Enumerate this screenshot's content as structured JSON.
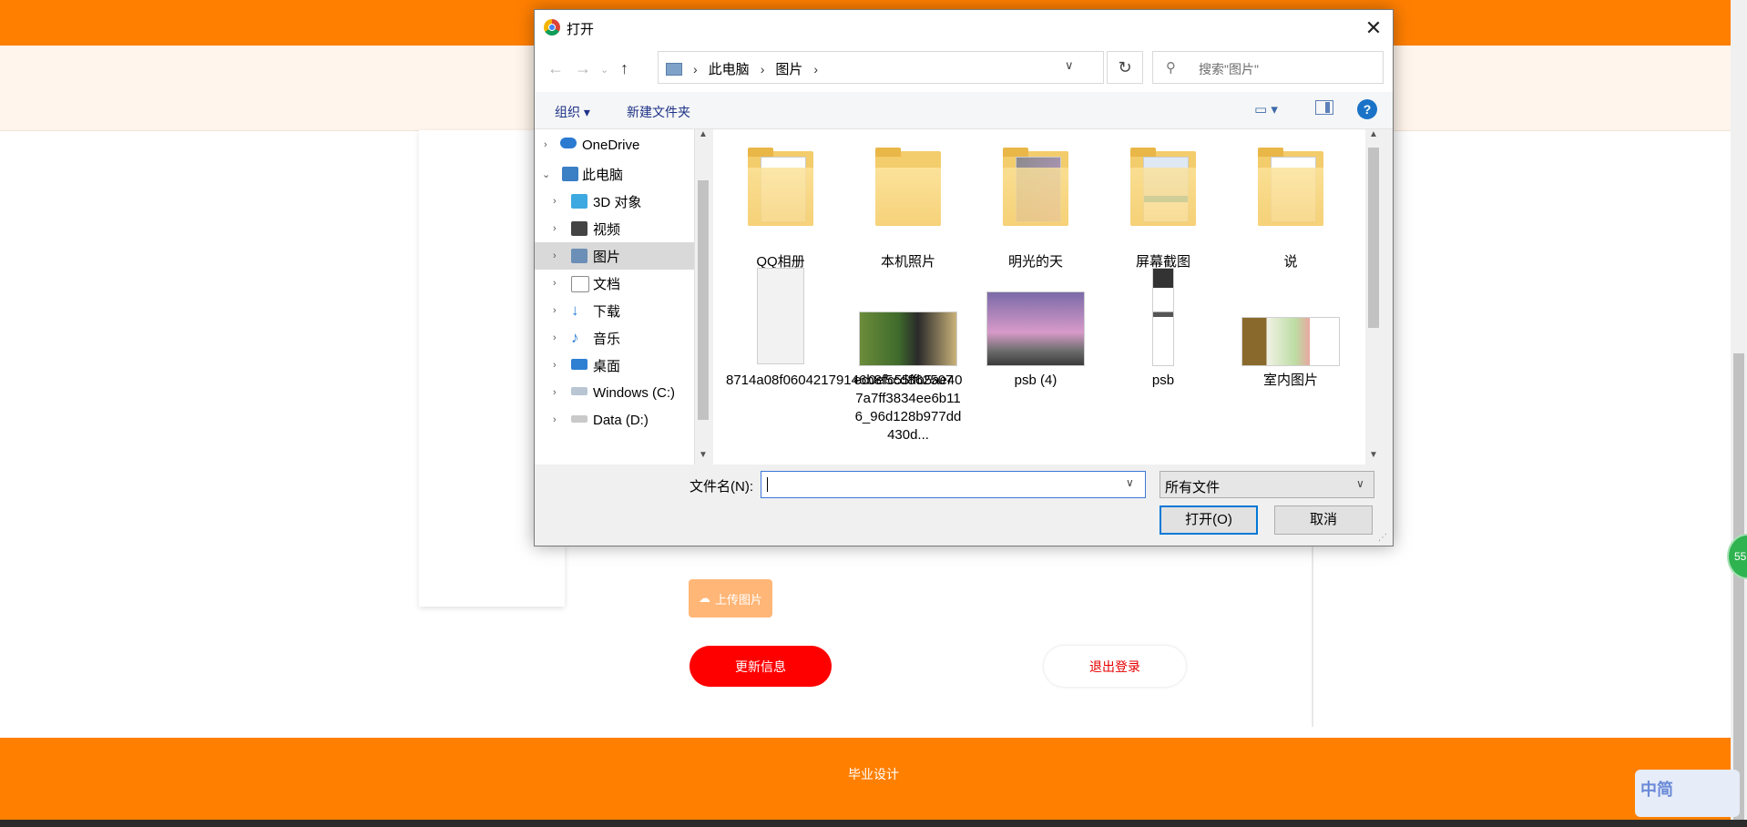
{
  "page": {
    "upload_label": "上传图片",
    "update_label": "更新信息",
    "logout_label": "退出登录",
    "footer_text": "毕业设计",
    "float_badge": "55",
    "ime_text": "中简"
  },
  "dialog": {
    "title": "打开",
    "close_glyph": "✕",
    "breadcrumb": [
      "此电脑",
      "图片"
    ],
    "search_placeholder": "搜索\"图片\"",
    "toolbar": {
      "organize": "组织 ▾",
      "new_folder": "新建文件夹"
    },
    "tree": [
      {
        "label": "OneDrive",
        "icon": "cloud-icon",
        "color": "#2a7ad2"
      },
      {
        "label": "此电脑",
        "icon": "computer-icon",
        "color": "#3b7fc4"
      },
      {
        "label": "3D 对象",
        "icon": "cube-icon",
        "color": "#3ea9e0"
      },
      {
        "label": "视频",
        "icon": "film-icon",
        "color": "#444444"
      },
      {
        "label": "图片",
        "icon": "pictures-icon",
        "color": "#6b8fb6",
        "selected": true
      },
      {
        "label": "文档",
        "icon": "document-icon",
        "color": "#8a8a8a"
      },
      {
        "label": "下载",
        "icon": "download-icon",
        "color": "#2f7fd3"
      },
      {
        "label": "音乐",
        "icon": "music-icon",
        "color": "#2f7fd3"
      },
      {
        "label": "桌面",
        "icon": "desktop-icon",
        "color": "#2f7fd3"
      },
      {
        "label": "Windows (C:)",
        "icon": "drive-icon",
        "color": "#6b8fb6"
      },
      {
        "label": "Data (D:)",
        "icon": "drive-icon",
        "color": "#9a9a9a"
      }
    ],
    "files": [
      {
        "name": "QQ相册",
        "kind": "folder"
      },
      {
        "name": "本机照片",
        "kind": "folder"
      },
      {
        "name": "明光的天",
        "kind": "folder"
      },
      {
        "name": "屏幕截图",
        "kind": "folder"
      },
      {
        "name": "说",
        "kind": "folder"
      },
      {
        "name": "8714a08f06042179146b8f5cd862507",
        "kind": "image"
      },
      {
        "name": "ec0efc55ffb5ae407a7ff3834ee6b116_96d128b977dd430d...",
        "kind": "image"
      },
      {
        "name": "psb (4)",
        "kind": "image"
      },
      {
        "name": "psb",
        "kind": "image"
      },
      {
        "name": "室内图片",
        "kind": "image"
      }
    ],
    "filename_label": "文件名(N):",
    "filename_value": "",
    "filetype_value": "所有文件",
    "open_label": "打开(O)",
    "cancel_label": "取消"
  },
  "colors": {
    "brand_orange": "#ff7f00",
    "danger_red": "#ff0000",
    "selection_blue": "#0078d7"
  }
}
